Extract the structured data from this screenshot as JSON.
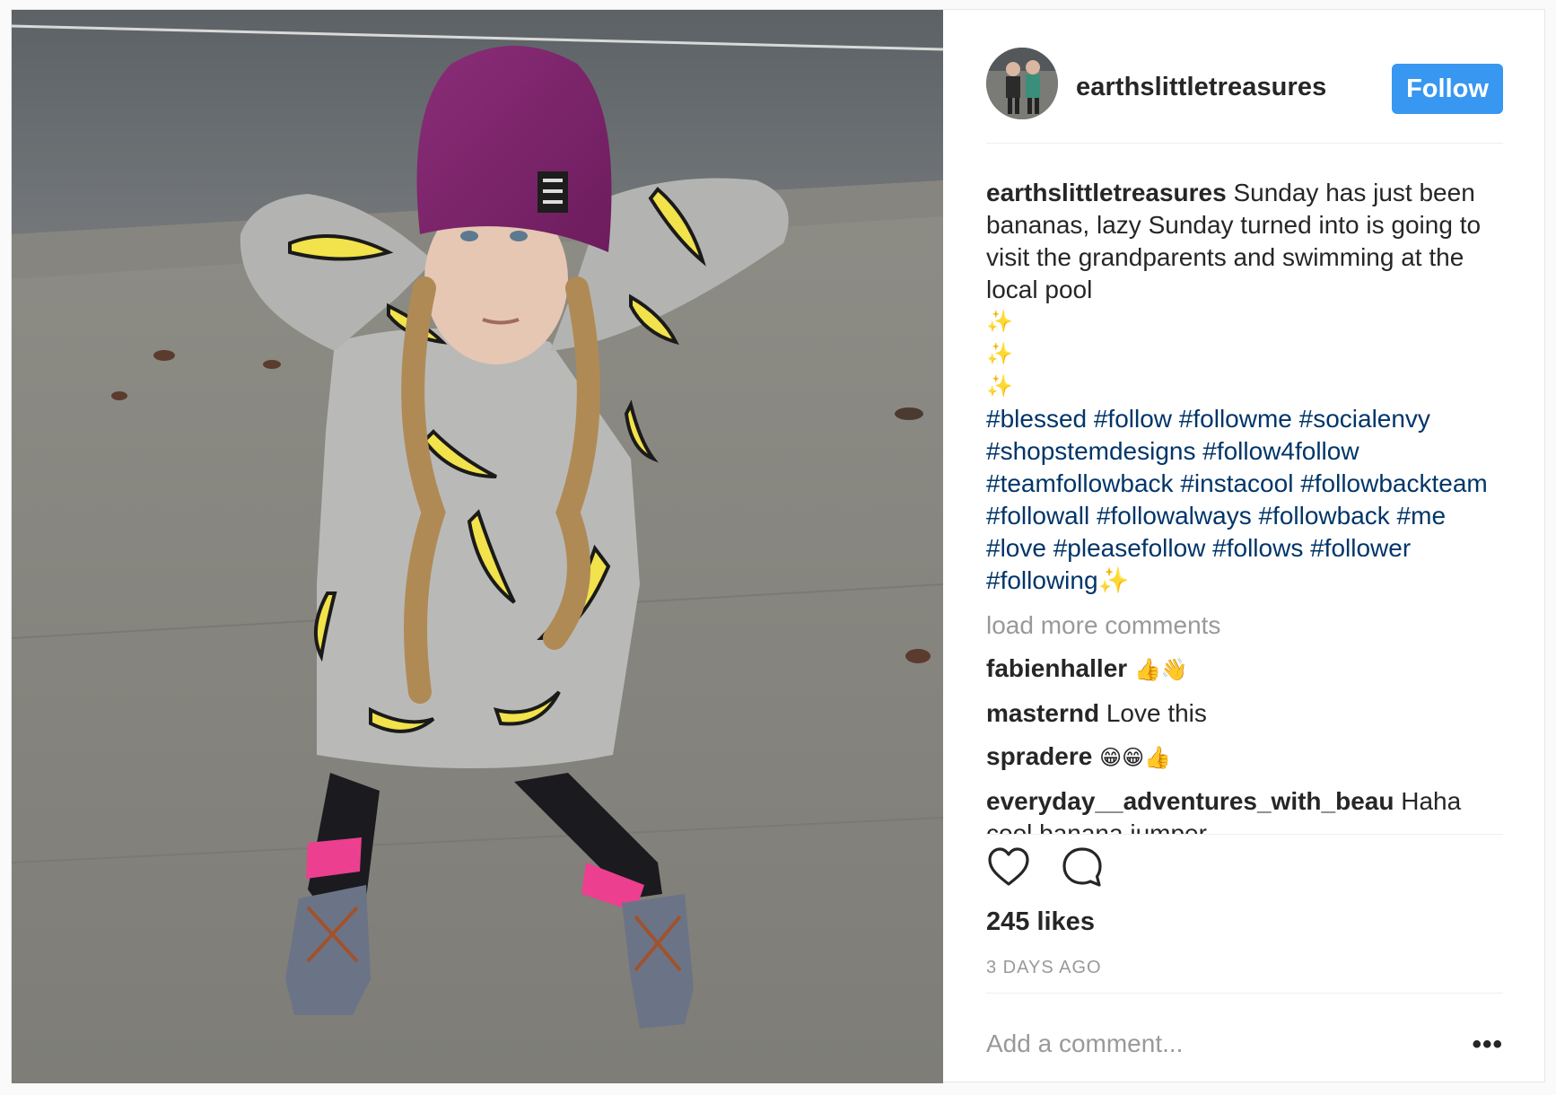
{
  "post": {
    "username": "earthslittletreasures",
    "follow_label": "Follow",
    "caption_text": "Sunday has just been bananas, lazy Sunday turned into is going to visit the grandparents and swimming at the local pool",
    "sparkles": [
      "✨",
      "✨",
      "✨"
    ],
    "hashtags_text": "#blessed #follow #followme #socialenvy #shopstemdesigns #follow4follow #teamfollowback #instacool #followbackteam #followall #followalways #followback #me #love #pleasefollow #follows #follower #following",
    "hashtags_suffix": "✨",
    "load_more": "load more comments",
    "comments": [
      {
        "user": "fabienhaller",
        "text": "👍👋"
      },
      {
        "user": "masternd",
        "text": "Love this"
      },
      {
        "user": "spradere",
        "text": "😁😁👍"
      },
      {
        "user": "everyday__adventures_with_beau",
        "text": "Haha cool banana jumper"
      }
    ],
    "likes": "245 likes",
    "time": "3 DAYS AGO",
    "add_comment_placeholder": "Add a comment...",
    "more_label": "•••"
  },
  "colors": {
    "follow_button": "#3897f0",
    "hashtag": "#003569",
    "muted": "#999999"
  },
  "icons": [
    "heart-icon",
    "comment-icon",
    "more-options-icon"
  ]
}
